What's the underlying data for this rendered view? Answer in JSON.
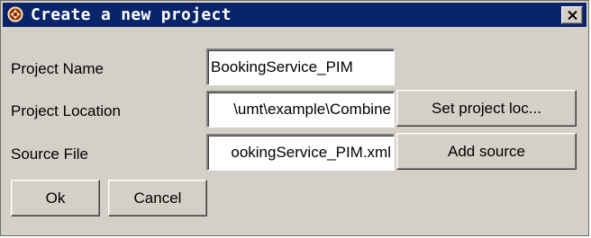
{
  "window": {
    "title": "Create a new project"
  },
  "icons": {
    "title_icon": "app-logo-icon",
    "close_icon": "close-icon"
  },
  "form": {
    "project_name": {
      "label": "Project Name",
      "value": "BookingService_PIM"
    },
    "project_location": {
      "label": "Project Location",
      "value": "\\umt\\example\\Combine",
      "button_label": "Set project loc..."
    },
    "source_file": {
      "label": "Source File",
      "value": "ookingService_PIM.xml",
      "button_label": "Add source"
    }
  },
  "buttons": {
    "ok_label": "Ok",
    "cancel_label": "Cancel"
  },
  "colors": {
    "titlebar": "#0a246a",
    "title_text": "#ffffff",
    "dialog_face": "#d4d0c8",
    "field_background": "#ffffff"
  }
}
